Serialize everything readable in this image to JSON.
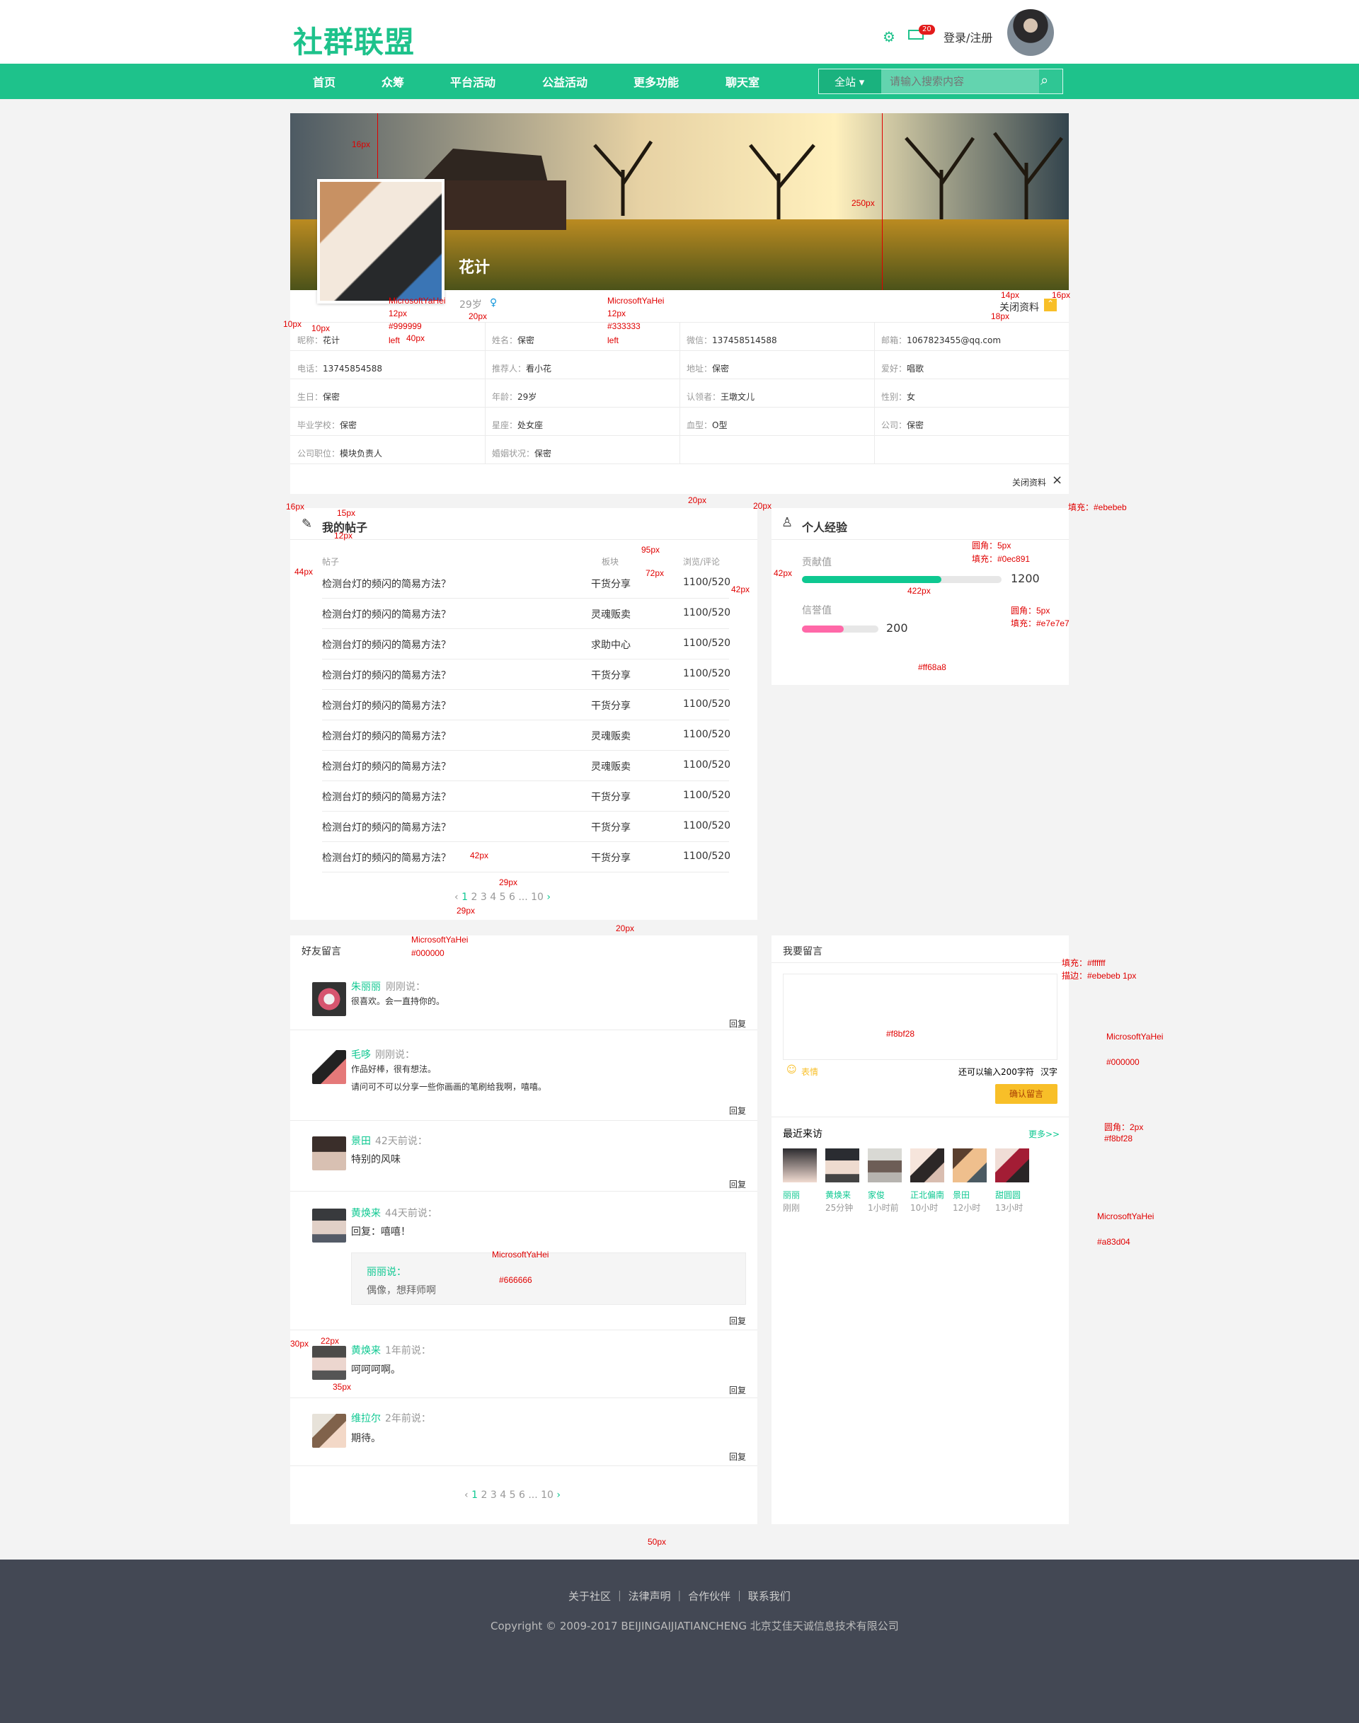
{
  "header": {
    "logo": "社群联盟",
    "mail_count": "20",
    "login": "登录/注册"
  },
  "nav": {
    "items": [
      "首页",
      "众筹",
      "平台活动",
      "公益活动",
      "更多功能",
      "聊天室"
    ],
    "search_scope": "全站",
    "search_placeholder": "请输入搜索内容"
  },
  "profile": {
    "name": "花计",
    "age": "29岁",
    "close_info": "关闭资料",
    "close_bottom": "关闭资料"
  },
  "info": [
    [
      "昵称：",
      "花计",
      "姓名：",
      "保密",
      "微信：",
      "137458514588",
      "邮箱：",
      "1067823455@qq.com"
    ],
    [
      "电话：",
      "13745854588",
      "推荐人：",
      "看小花",
      "地址：",
      "保密",
      "爱好：",
      "唱歌"
    ],
    [
      "生日：",
      "保密",
      "年龄：",
      "29岁",
      "认领者：",
      "王墩文儿",
      "性别：",
      "女"
    ],
    [
      "毕业学校：",
      "保密",
      "星座：",
      "处女座",
      "血型：",
      "O型",
      "公司：",
      "保密"
    ],
    [
      "公司职位：",
      "模块负责人",
      "婚姻状况：",
      "保密",
      "",
      "",
      "",
      ""
    ]
  ],
  "posts": {
    "title": "我的帖子",
    "headers": [
      "帖子",
      "板块",
      "浏览/评论"
    ],
    "rows": [
      [
        "检测台灯的频闪的简易方法？",
        "干货分享",
        "1100/520"
      ],
      [
        "检测台灯的频闪的简易方法？",
        "灵魂贩卖",
        "1100/520"
      ],
      [
        "检测台灯的频闪的简易方法？",
        "求助中心",
        "1100/520"
      ],
      [
        "检测台灯的频闪的简易方法？",
        "干货分享",
        "1100/520"
      ],
      [
        "检测台灯的频闪的简易方法？",
        "干货分享",
        "1100/520"
      ],
      [
        "检测台灯的频闪的简易方法？",
        "灵魂贩卖",
        "1100/520"
      ],
      [
        "检测台灯的频闪的简易方法？",
        "灵魂贩卖",
        "1100/520"
      ],
      [
        "检测台灯的频闪的简易方法？",
        "干货分享",
        "1100/520"
      ],
      [
        "检测台灯的频闪的简易方法？",
        "干货分享",
        "1100/520"
      ],
      [
        "检测台灯的频闪的简易方法？",
        "干货分享",
        "1100/520"
      ]
    ],
    "pager": [
      "1",
      "2",
      "3",
      "4",
      "5",
      "6",
      "...",
      "10"
    ]
  },
  "experience": {
    "title": "个人经验",
    "contribution": "贡献值",
    "contribution_value": "1200",
    "contribution_fill": 0.7,
    "credit": "信誉值",
    "credit_value": "200",
    "credit_fill": 0.55
  },
  "messages": {
    "title": "好友留言",
    "items": [
      {
        "name": "朱丽丽",
        "time": "刚刚说：",
        "text": [
          "很喜欢。会一直持你的。"
        ]
      },
      {
        "name": "毛哆",
        "time": "刚刚说：",
        "text": [
          "作品好棒，很有想法。",
          "请问可不可以分享一些你画画的笔刷给我啊，嘻嘻。"
        ]
      },
      {
        "name": "景田",
        "time": "42天前说：",
        "text": [
          "特别的风味"
        ]
      },
      {
        "name": "黄焕来",
        "time": "44天前说：",
        "text": [
          "回复：嘻嘻！"
        ],
        "quote_name": "丽丽说：",
        "quote_text": "偶像，想拜师啊"
      },
      {
        "name": "黄焕来",
        "time": "1年前说：",
        "text": [
          "呵呵呵啊。"
        ]
      },
      {
        "name": "维拉尔",
        "time": "2年前说：",
        "text": [
          "期待。"
        ]
      }
    ],
    "reply": "回复",
    "pager": [
      "1",
      "2",
      "3",
      "4",
      "5",
      "6",
      "...",
      "10"
    ]
  },
  "leave": {
    "title": "我要留言",
    "emoji": "表情",
    "counter": "还可以输入200字符",
    "chinese": "汉字",
    "submit": "确认留言"
  },
  "visitors": {
    "title": "最近来访",
    "more": "更多>>",
    "items": [
      {
        "name": "丽丽",
        "time": "刚刚"
      },
      {
        "name": "黄焕来",
        "time": "25分钟"
      },
      {
        "name": "家俊",
        "time": "1小时前"
      },
      {
        "name": "正北偏南",
        "time": "10小时"
      },
      {
        "name": "景田",
        "time": "12小时"
      },
      {
        "name": "甜圆圆",
        "time": "13小时"
      }
    ]
  },
  "footer": {
    "links": [
      "关于社区",
      "法律声明",
      "合作伙伴",
      "联系我们"
    ],
    "copyright": "Copyright © 2009-2017 BEIJINGAIJIATIANCHENG 北京艾佳天诚信息技术有限公司"
  },
  "annotations": [
    "250px",
    "14px",
    "16px",
    "18px",
    "10px",
    "20px",
    "MicrosoftYaHei",
    "12px",
    "#999999",
    "left",
    "40px",
    "#333333",
    "15px",
    "95px",
    "72px",
    "44px",
    "42px",
    "422px",
    "圆角：5px",
    "填充：#0ec891",
    "填充：#e7e7e7",
    "填充：#ebebeb",
    "#ff68a8",
    "#000000",
    "#f8bf28",
    "#a83d04",
    "圆角：2px",
    "描边：#ebebeb 1px",
    "50px",
    "29px",
    "22px",
    "30px",
    "35px",
    "#666666",
    "填充：#ffffff"
  ]
}
